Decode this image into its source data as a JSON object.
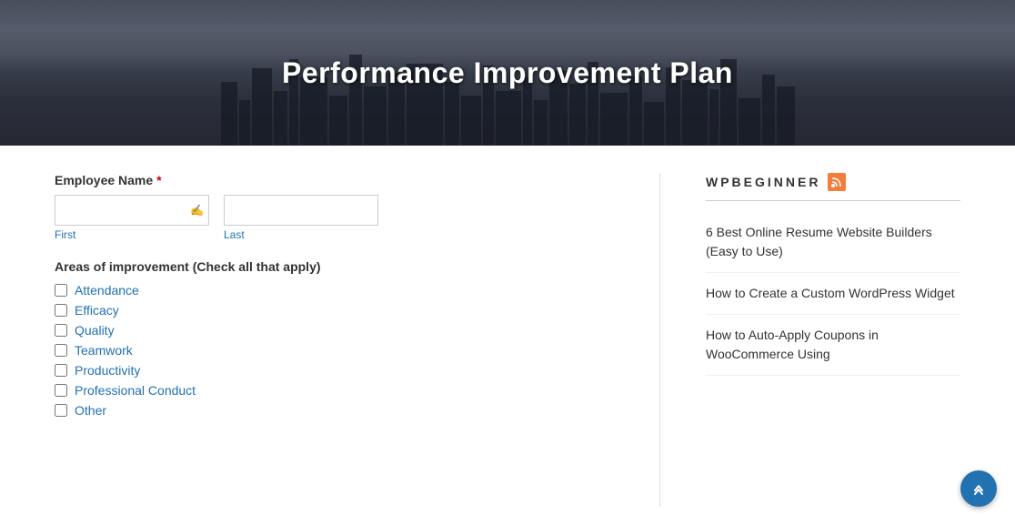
{
  "hero": {
    "title": "Performance Improvement Plan"
  },
  "form": {
    "employee_name_label": "Employee Name",
    "required_mark": "*",
    "first_label": "First",
    "last_label": "Last",
    "areas_label": "Areas of improvement (Check all that apply)",
    "checkboxes": [
      {
        "id": "attendance",
        "label": "Attendance"
      },
      {
        "id": "efficacy",
        "label": "Efficacy"
      },
      {
        "id": "quality",
        "label": "Quality"
      },
      {
        "id": "teamwork",
        "label": "Teamwork"
      },
      {
        "id": "productivity",
        "label": "Productivity"
      },
      {
        "id": "professional_conduct",
        "label": "Professional Conduct"
      },
      {
        "id": "other",
        "label": "Other"
      }
    ]
  },
  "sidebar": {
    "title": "WPBEGINNER",
    "links": [
      {
        "text": "6 Best Online Resume Website Builders (Easy to Use)"
      },
      {
        "text": "How to Create a Custom WordPress Widget"
      },
      {
        "text": "How to Auto-Apply Coupons in WooCommerce Using"
      }
    ]
  },
  "scroll_top": "❮❮"
}
